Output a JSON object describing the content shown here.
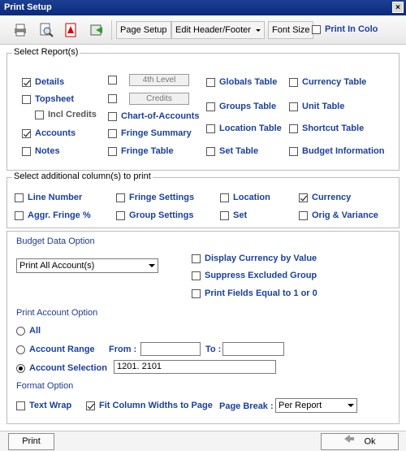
{
  "window": {
    "title": "Print Setup",
    "close_glyph": "×"
  },
  "toolbar": {
    "icons": [
      "printer-icon",
      "preview-icon",
      "pdf-icon",
      "export-icon"
    ],
    "page_setup": "Page Setup",
    "edit_header_footer": "Edit Header/Footer",
    "font_size": "Font Size",
    "print_in_color": "Print In Colo"
  },
  "select_reports": {
    "legend": "Select Report(s)",
    "items": [
      {
        "label": "Details",
        "checked": true
      },
      {
        "label": "Topsheet",
        "checked": false
      },
      {
        "label": "Incl Credits",
        "checked": false
      },
      {
        "label": "Accounts",
        "checked": true
      },
      {
        "label": "Notes",
        "checked": false
      },
      {
        "label": "4th Level",
        "checked": false
      },
      {
        "label": "Credits",
        "checked": false
      },
      {
        "label": "Chart-of-Accounts",
        "checked": false
      },
      {
        "label": "Fringe Summary",
        "checked": false
      },
      {
        "label": "Fringe Table",
        "checked": false
      },
      {
        "label": "Globals Table",
        "checked": false
      },
      {
        "label": "Groups Table",
        "checked": false
      },
      {
        "label": "Location Table",
        "checked": false
      },
      {
        "label": "Set Table",
        "checked": false
      },
      {
        "label": "Currency Table",
        "checked": false
      },
      {
        "label": "Unit Table",
        "checked": false
      },
      {
        "label": "Shortcut Table",
        "checked": false
      },
      {
        "label": "Budget Information",
        "checked": false
      }
    ]
  },
  "additional_columns": {
    "legend": "Select additional column(s) to print",
    "items": [
      {
        "label": "Line Number",
        "checked": false
      },
      {
        "label": "Fringe Settings",
        "checked": false
      },
      {
        "label": "Location",
        "checked": false
      },
      {
        "label": "Currency",
        "checked": true
      },
      {
        "label": "Aggr. Fringe %",
        "checked": false
      },
      {
        "label": "Group Settings",
        "checked": false
      },
      {
        "label": "Set",
        "checked": false
      },
      {
        "label": "Orig & Variance",
        "checked": false
      }
    ]
  },
  "budget_data": {
    "title": "Budget Data Option",
    "dropdown_value": "Print All Account(s)",
    "display_currency": "Display Currency by Value",
    "suppress_excluded": "Suppress Excluded Group",
    "print_fields_equal": "Print Fields Equal to 1 or 0"
  },
  "print_account": {
    "title": "Print Account Option",
    "all": "All",
    "account_range": "Account Range",
    "from_label": "From :",
    "to_label": "To :",
    "from_value": "",
    "to_value": "",
    "account_selection": "Account Selection",
    "selection_value": "1201. 2101",
    "selected": "Account Selection"
  },
  "format": {
    "title": "Format Option",
    "text_wrap": "Text Wrap",
    "text_wrap_checked": false,
    "fit_columns": "Fit Column Widths to Page",
    "fit_columns_checked": true,
    "page_break_label": "Page Break :",
    "page_break_value": "Per Report"
  },
  "footer": {
    "print": "Print",
    "ok": "Ok"
  }
}
